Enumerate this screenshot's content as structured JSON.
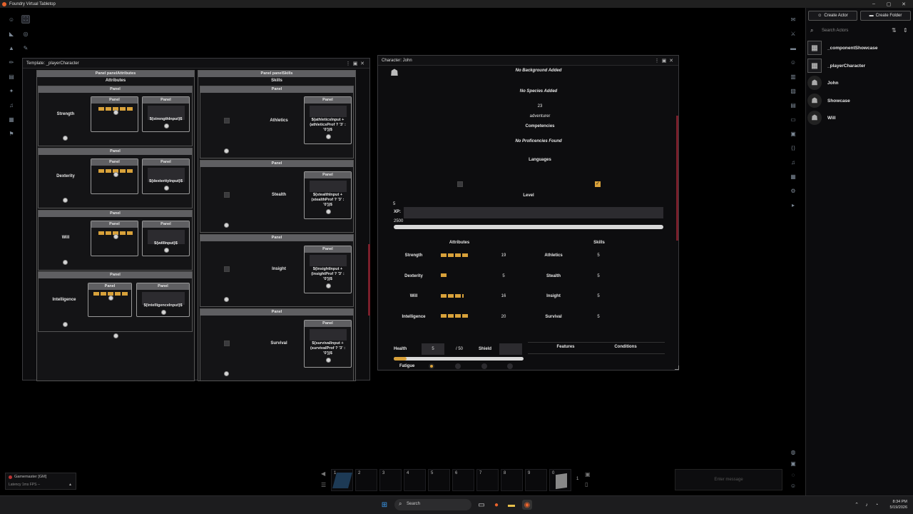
{
  "app": {
    "title": "Foundry Virtual Tabletop",
    "window_controls": [
      "–",
      "▢",
      "✕"
    ]
  },
  "template_window": {
    "title": "Template: _playerCharacter",
    "col_attr": {
      "header": "Panel panelAttributes",
      "sub": "Attributes",
      "panel": "Panel"
    },
    "col_skill": {
      "header": "Panel panelSkills",
      "sub": "Skills",
      "panel": "Panel"
    },
    "attr_rows": [
      {
        "header": "Panel",
        "name": "Strength",
        "left_header": "Panel",
        "right_header": "Panel",
        "input": "${strengthInput}$",
        "pips": 5
      },
      {
        "header": "Panel",
        "name": "Dexterity",
        "left_header": "Panel",
        "right_header": "Panel",
        "input": "${dexterityInput}$",
        "pips": 5
      },
      {
        "header": "Panel",
        "name": "Will",
        "left_header": "Panel",
        "right_header": "Panel",
        "input": "${willInput}$",
        "pips": 5
      },
      {
        "header": "Panel",
        "name": "Intelligence",
        "left_header": "Panel",
        "right_header": "Panel",
        "input": "${intelligenceInput}$",
        "pips": 5
      }
    ],
    "skill_rows": [
      {
        "header": "Panel",
        "name": "Athletics",
        "box_header": "Panel",
        "formula": [
          "${athleticsInput +",
          "(athleticsProf ? '3' :",
          "'0')}$"
        ]
      },
      {
        "header": "Panel",
        "name": "Stealth",
        "box_header": "Panel",
        "formula": [
          "${stealthInput +",
          "(stealthProf ? '3' :",
          "'0')}$"
        ]
      },
      {
        "header": "Panel",
        "name": "Insight",
        "box_header": "Panel",
        "formula": [
          "${insightInput +",
          "(insightProf ? '3' :",
          "'0')}$"
        ]
      },
      {
        "header": "Panel",
        "name": "Survival",
        "box_header": "Panel",
        "formula": [
          "${survivalInput +",
          "(survivalProf ? '3' :",
          "'0')}$"
        ]
      }
    ]
  },
  "character_window": {
    "title": "Character: John",
    "no_background": "No Background Added",
    "no_species": "No Species Added",
    "age": "23",
    "role": "adventurer",
    "competencies": "Competencies",
    "no_prof": "No Proficencies Found",
    "languages": "Languages",
    "level_label": "Level",
    "level_value": "5",
    "xp_label": "XP:",
    "xp_max": "2500",
    "attributes_title": "Attributes",
    "skills_title": "Skills",
    "attributes": [
      {
        "name": "Strength",
        "value": "19",
        "pips": 4
      },
      {
        "name": "Dexterity",
        "value": "5",
        "pips": 1
      },
      {
        "name": "Will",
        "value": "16",
        "pips": 3
      },
      {
        "name": "Intelligence",
        "value": "20",
        "pips": 4
      }
    ],
    "skills": [
      {
        "name": "Athletics",
        "value": "5"
      },
      {
        "name": "Stealth",
        "value": "5"
      },
      {
        "name": "Insight",
        "value": "5"
      },
      {
        "name": "Survival",
        "value": "5"
      }
    ],
    "health_label": "Health",
    "health_value": "5",
    "health_max": "/ 50",
    "shield_label": "Shield",
    "fatigue_label": "Fatigue",
    "tabs": [
      "Features",
      "Conditions"
    ]
  },
  "sidebar": {
    "create_actor": "Create Actor",
    "create_folder": "Create Folder",
    "search_placeholder": "Search Actors",
    "actors": [
      "_componentShowcase",
      "_playerCharacter",
      "John",
      "Showcase",
      "Will"
    ]
  },
  "players": {
    "name": "Gamemaster [GM]",
    "latency": "Latency  1ms  FPS  --"
  },
  "hotbar": {
    "slots": [
      "1",
      "2",
      "3",
      "4",
      "5",
      "6",
      "7",
      "8",
      "9",
      "0"
    ],
    "page": "1"
  },
  "chat": {
    "placeholder": "Enter message"
  },
  "taskbar": {
    "search": "Search",
    "time": "8:34 PM",
    "date": "5/19/2026"
  },
  "colors": {
    "accent": "#d8a13a",
    "panel_header": "#5f5f62",
    "scrollbar": "#7a1f2b"
  }
}
